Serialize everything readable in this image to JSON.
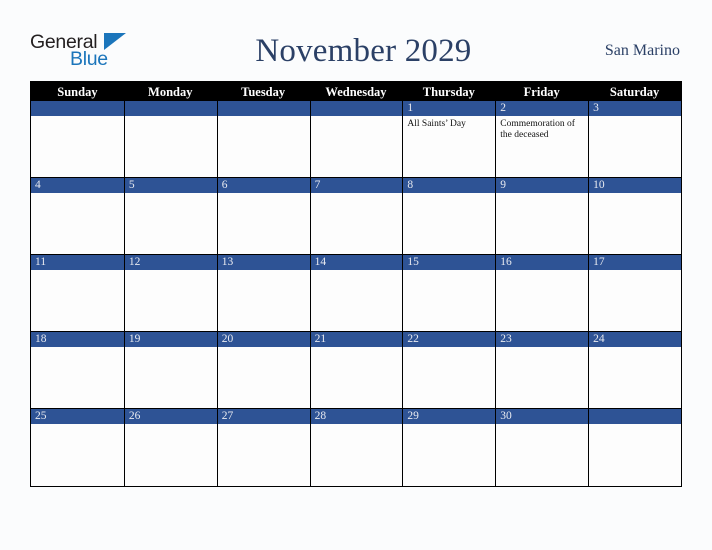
{
  "brand": {
    "logo_text_top": "General",
    "logo_text_bottom": "Blue",
    "logo_dark_color": "#231f20",
    "logo_blue_color": "#1b75bb"
  },
  "header": {
    "title": "November 2029",
    "locale": "San Marino"
  },
  "theme": {
    "weekday_header_bg": "#000000",
    "weekday_header_text": "#ffffff",
    "daynum_band_bg": "#2e5395",
    "daynum_text": "#e8eaf0",
    "cell_bg": "#fdfdfd",
    "page_bg": "#fbfcfd",
    "title_color": "#2b4066",
    "grid_line": "#000000"
  },
  "weekdays": [
    "Sunday",
    "Monday",
    "Tuesday",
    "Wednesday",
    "Thursday",
    "Friday",
    "Saturday"
  ],
  "weeks": [
    [
      {
        "day": "",
        "events": []
      },
      {
        "day": "",
        "events": []
      },
      {
        "day": "",
        "events": []
      },
      {
        "day": "",
        "events": []
      },
      {
        "day": "1",
        "events": [
          "All Saints’ Day"
        ]
      },
      {
        "day": "2",
        "events": [
          "Commemoration of the deceased"
        ]
      },
      {
        "day": "3",
        "events": []
      }
    ],
    [
      {
        "day": "4",
        "events": []
      },
      {
        "day": "5",
        "events": []
      },
      {
        "day": "6",
        "events": []
      },
      {
        "day": "7",
        "events": []
      },
      {
        "day": "8",
        "events": []
      },
      {
        "day": "9",
        "events": []
      },
      {
        "day": "10",
        "events": []
      }
    ],
    [
      {
        "day": "11",
        "events": []
      },
      {
        "day": "12",
        "events": []
      },
      {
        "day": "13",
        "events": []
      },
      {
        "day": "14",
        "events": []
      },
      {
        "day": "15",
        "events": []
      },
      {
        "day": "16",
        "events": []
      },
      {
        "day": "17",
        "events": []
      }
    ],
    [
      {
        "day": "18",
        "events": []
      },
      {
        "day": "19",
        "events": []
      },
      {
        "day": "20",
        "events": []
      },
      {
        "day": "21",
        "events": []
      },
      {
        "day": "22",
        "events": []
      },
      {
        "day": "23",
        "events": []
      },
      {
        "day": "24",
        "events": []
      }
    ],
    [
      {
        "day": "25",
        "events": []
      },
      {
        "day": "26",
        "events": []
      },
      {
        "day": "27",
        "events": []
      },
      {
        "day": "28",
        "events": []
      },
      {
        "day": "29",
        "events": []
      },
      {
        "day": "30",
        "events": []
      },
      {
        "day": "",
        "events": []
      }
    ]
  ]
}
